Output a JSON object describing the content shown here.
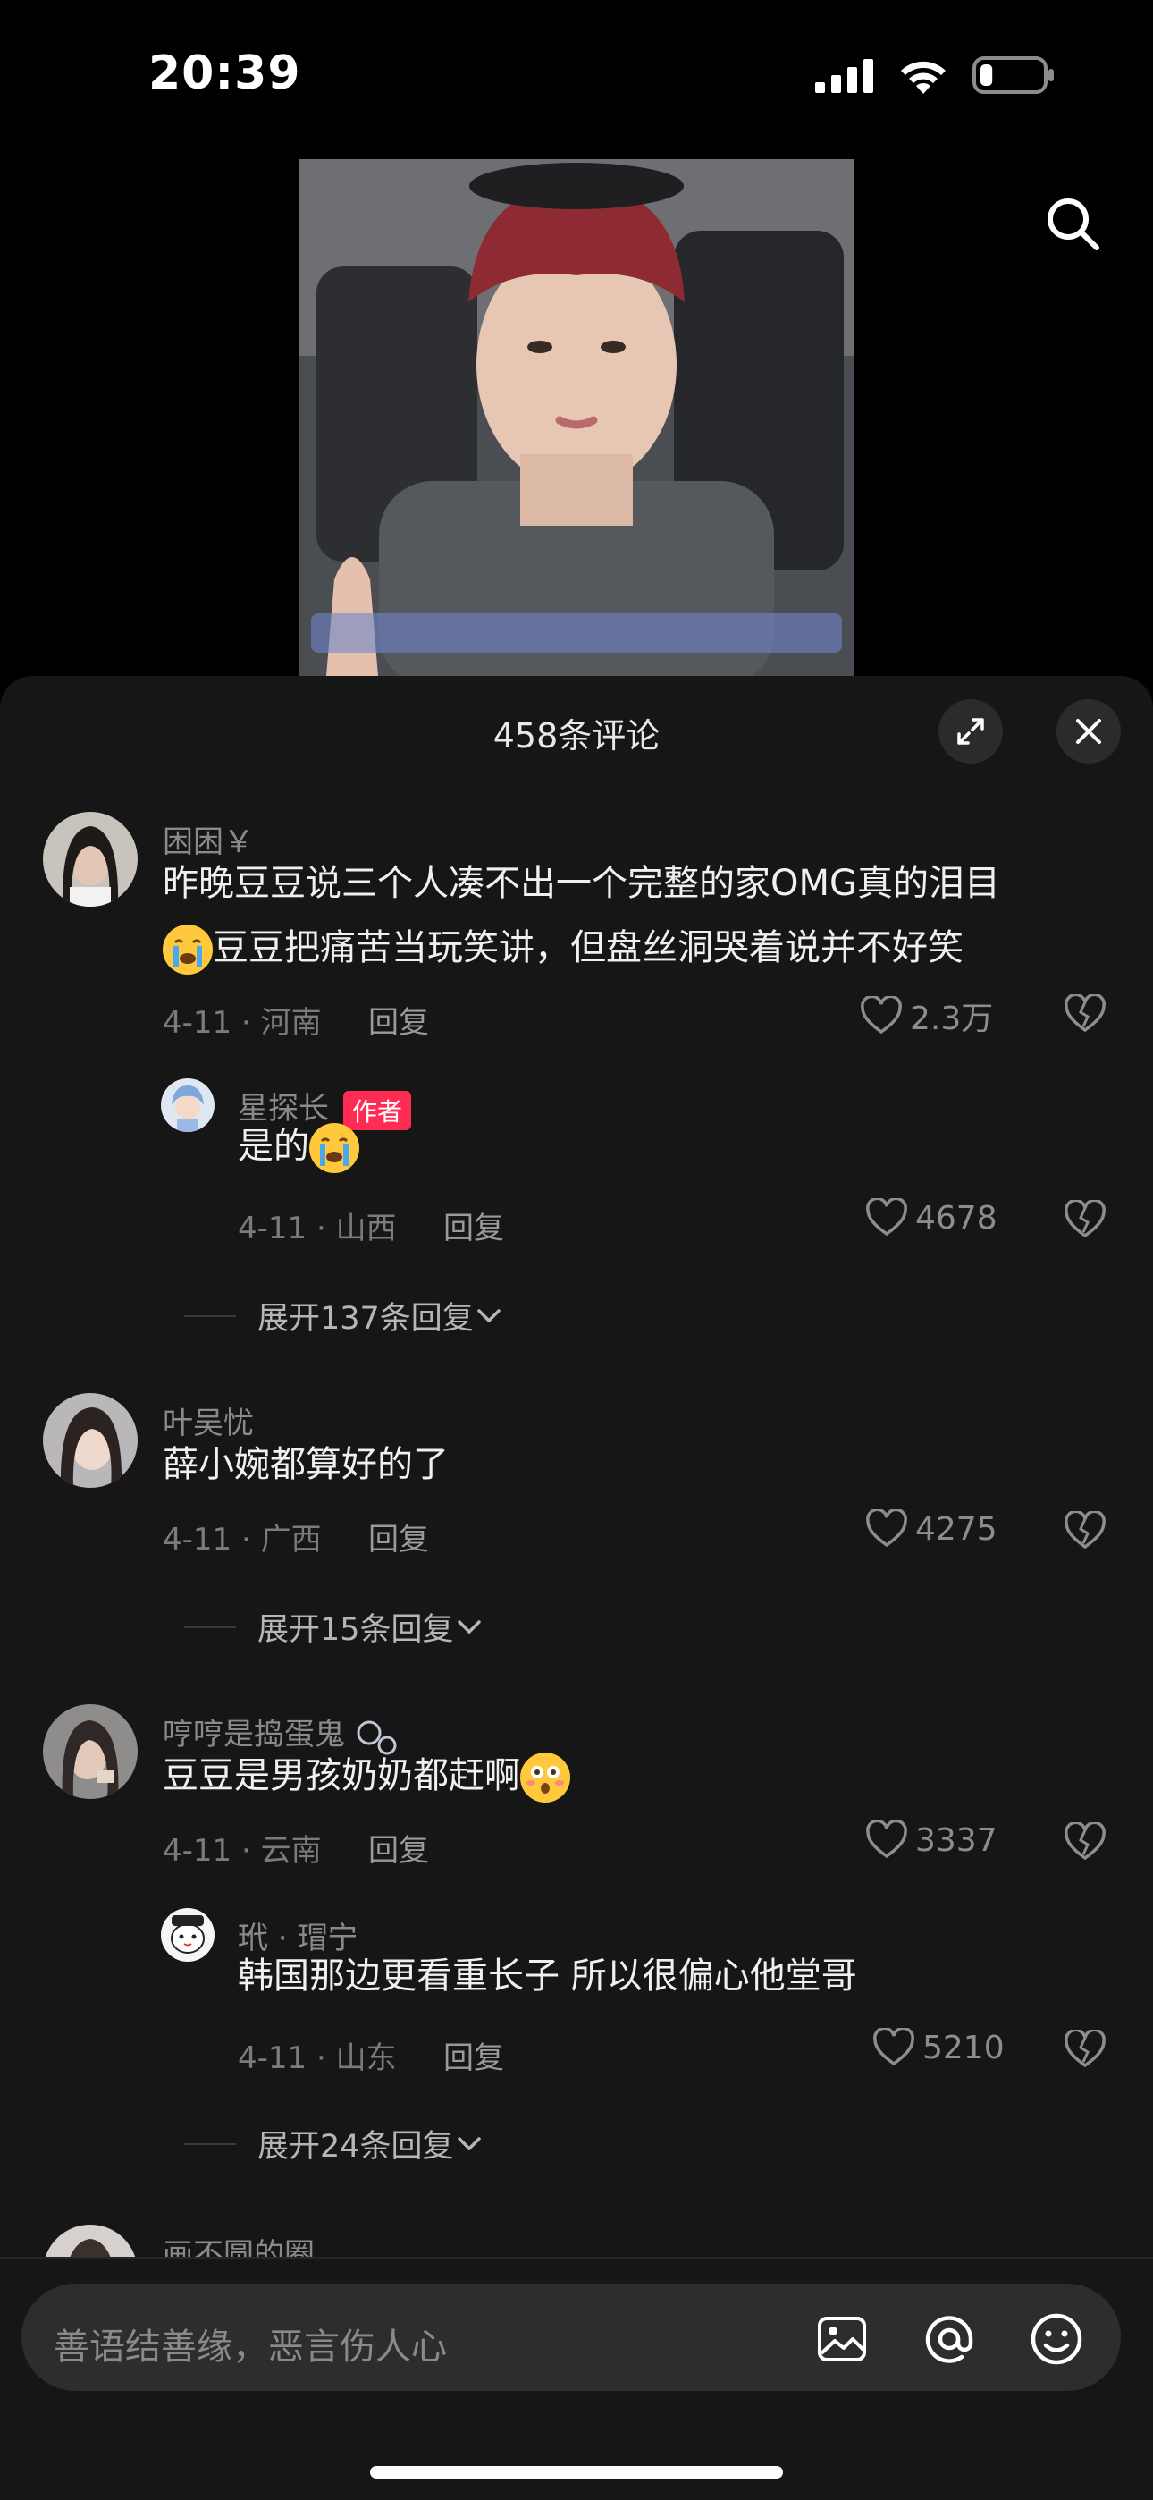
{
  "status_bar": {
    "time": "20:39",
    "battery_percent": 20
  },
  "sheet": {
    "title": "458条评论"
  },
  "comments": [
    {
      "nickname": "困困￥",
      "text_lines": [
        "昨晚豆豆说三个人凑不出一个完整的家OMG真的泪目",
        "豆豆把痛苦当玩笑讲，但盘丝洞哭着说并不好笑"
      ],
      "meta": "4-11 · 河南",
      "reply_label": "回复",
      "likes": "2.3万",
      "reply": {
        "nickname": "星探长",
        "badge": "作者",
        "text": "是的",
        "meta": "4-11 · 山西",
        "reply_label": "回复",
        "likes": "4678"
      },
      "expand_label": "展开137条回复"
    },
    {
      "nickname": "叶吴忧",
      "text": "薛小婉都算好的了",
      "meta": "4-11 · 广西",
      "reply_label": "回复",
      "likes": "4275",
      "expand_label": "展开15条回复"
    },
    {
      "nickname": "哼哼是捣蛋鬼",
      "text": "豆豆是男孩奶奶都赶啊",
      "meta": "4-11 · 云南",
      "reply_label": "回复",
      "likes": "3337",
      "reply": {
        "nickname": "玳 · 瑁宁",
        "text": "韩国那边更看重长子 所以很偏心他堂哥",
        "meta": "4-11 · 山东",
        "reply_label": "回复",
        "likes": "5210"
      },
      "expand_label": "展开24条回复"
    },
    {
      "nickname": "画不圆的圈"
    }
  ],
  "input": {
    "placeholder": "善语结善缘，恶言伤人心"
  },
  "icons": {
    "search": "search-icon",
    "expand": "expand-icon",
    "close": "close-icon",
    "like": "heart-icon",
    "dislike": "broken-heart-icon",
    "image": "image-icon",
    "mention": "at-icon",
    "emoji": "emoji-icon",
    "chevron": "chevron-down-icon"
  },
  "colors": {
    "accent": "#fe2c55",
    "sheet_bg": "#161616",
    "text": "#f0f0f0",
    "muted": "#8a8a8a"
  }
}
